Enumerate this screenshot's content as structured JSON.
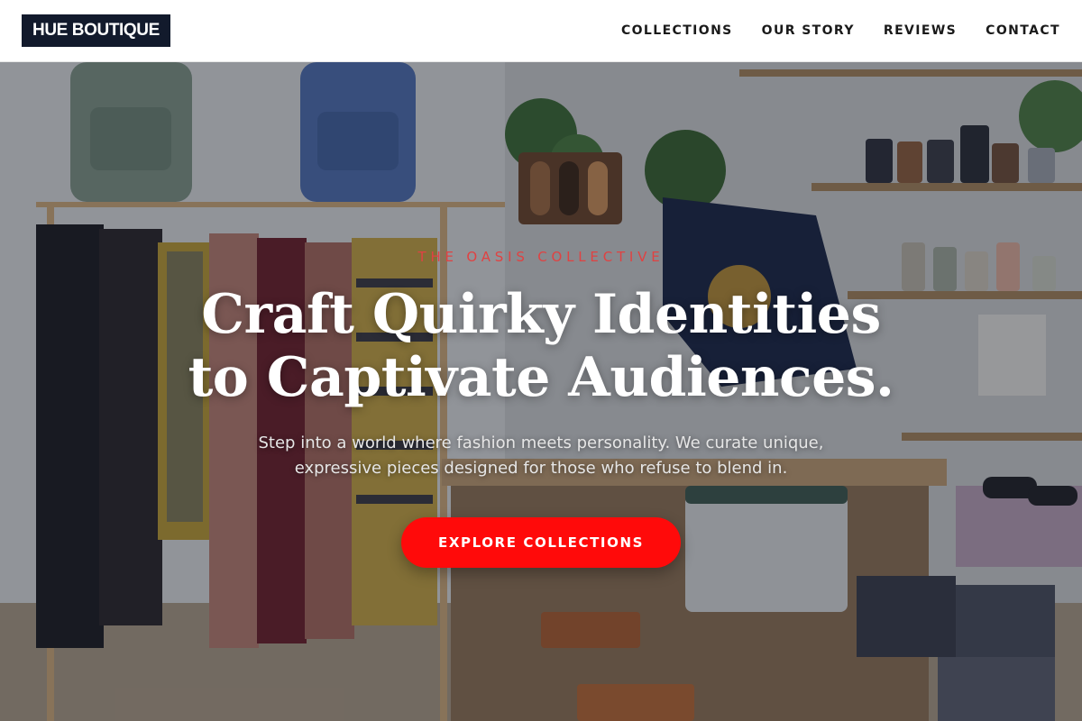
{
  "brand": {
    "logo_text": "HUE BOUTIQUE"
  },
  "nav": {
    "items": [
      {
        "label": "COLLECTIONS"
      },
      {
        "label": "OUR STORY"
      },
      {
        "label": "REVIEWS"
      },
      {
        "label": "CONTACT"
      }
    ]
  },
  "hero": {
    "eyebrow": "THE OASIS COLLECTIVE",
    "headline_line1": "Craft Quirky Identities",
    "headline_line2": "to Captivate Audiences.",
    "subtext": "Step into a world where fashion meets personality. We curate unique, expressive pieces designed for those who refuse to blend in.",
    "cta_label": "EXPLORE COLLECTIONS"
  },
  "colors": {
    "logo_background": "#121a2c",
    "accent": "#ff0a0a",
    "eyebrow": "#e04242",
    "header_background": "#ffffff"
  }
}
